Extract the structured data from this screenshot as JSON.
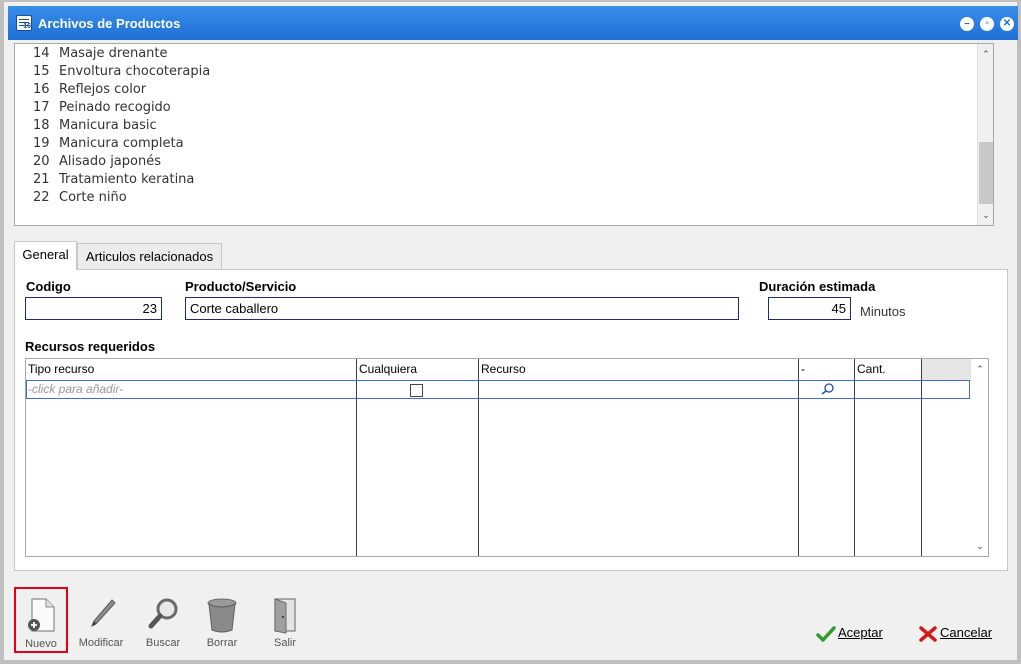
{
  "window": {
    "title": "Archivos de Productos",
    "app_icon_text": "16"
  },
  "list": {
    "items": [
      {
        "num": "14",
        "label": "Masaje drenante"
      },
      {
        "num": "15",
        "label": "Envoltura chocoterapia"
      },
      {
        "num": "16",
        "label": "Reflejos color"
      },
      {
        "num": "17",
        "label": "Peinado recogido"
      },
      {
        "num": "18",
        "label": "Manicura basic"
      },
      {
        "num": "19",
        "label": "Manicura completa"
      },
      {
        "num": "20",
        "label": "Alisado japonés"
      },
      {
        "num": "21",
        "label": "Tratamiento keratina"
      },
      {
        "num": "22",
        "label": "Corte niño"
      }
    ]
  },
  "tabs": [
    {
      "label": "General",
      "active": true
    },
    {
      "label": "Articulos relacionados",
      "active": false
    }
  ],
  "form": {
    "codigo_label": "Codigo",
    "codigo_value": "23",
    "producto_label": "Producto/Servicio",
    "producto_value": "Corte caballero",
    "duracion_label": "Duración estimada",
    "duracion_value": "45",
    "duracion_unit": "Minutos",
    "recursos_label": "Recursos requeridos"
  },
  "grid": {
    "columns": [
      "Tipo recurso",
      "Cualquiera",
      "Recurso",
      "-",
      "Cant."
    ],
    "new_row_placeholder": "-click para añadir-"
  },
  "toolbar": {
    "nuevo": "Nuevo",
    "modificar": "Modificar",
    "buscar": "Buscar",
    "borrar": "Borrar",
    "salir": "Salir"
  },
  "actions": {
    "aceptar": "Aceptar",
    "cancelar": "Cancelar"
  },
  "colors": {
    "titlebar": "#1f6fd6",
    "field_border": "#1b2c7a",
    "highlight": "#e8000e",
    "ok_green": "#2e9e2e",
    "cancel_red": "#d01818"
  }
}
